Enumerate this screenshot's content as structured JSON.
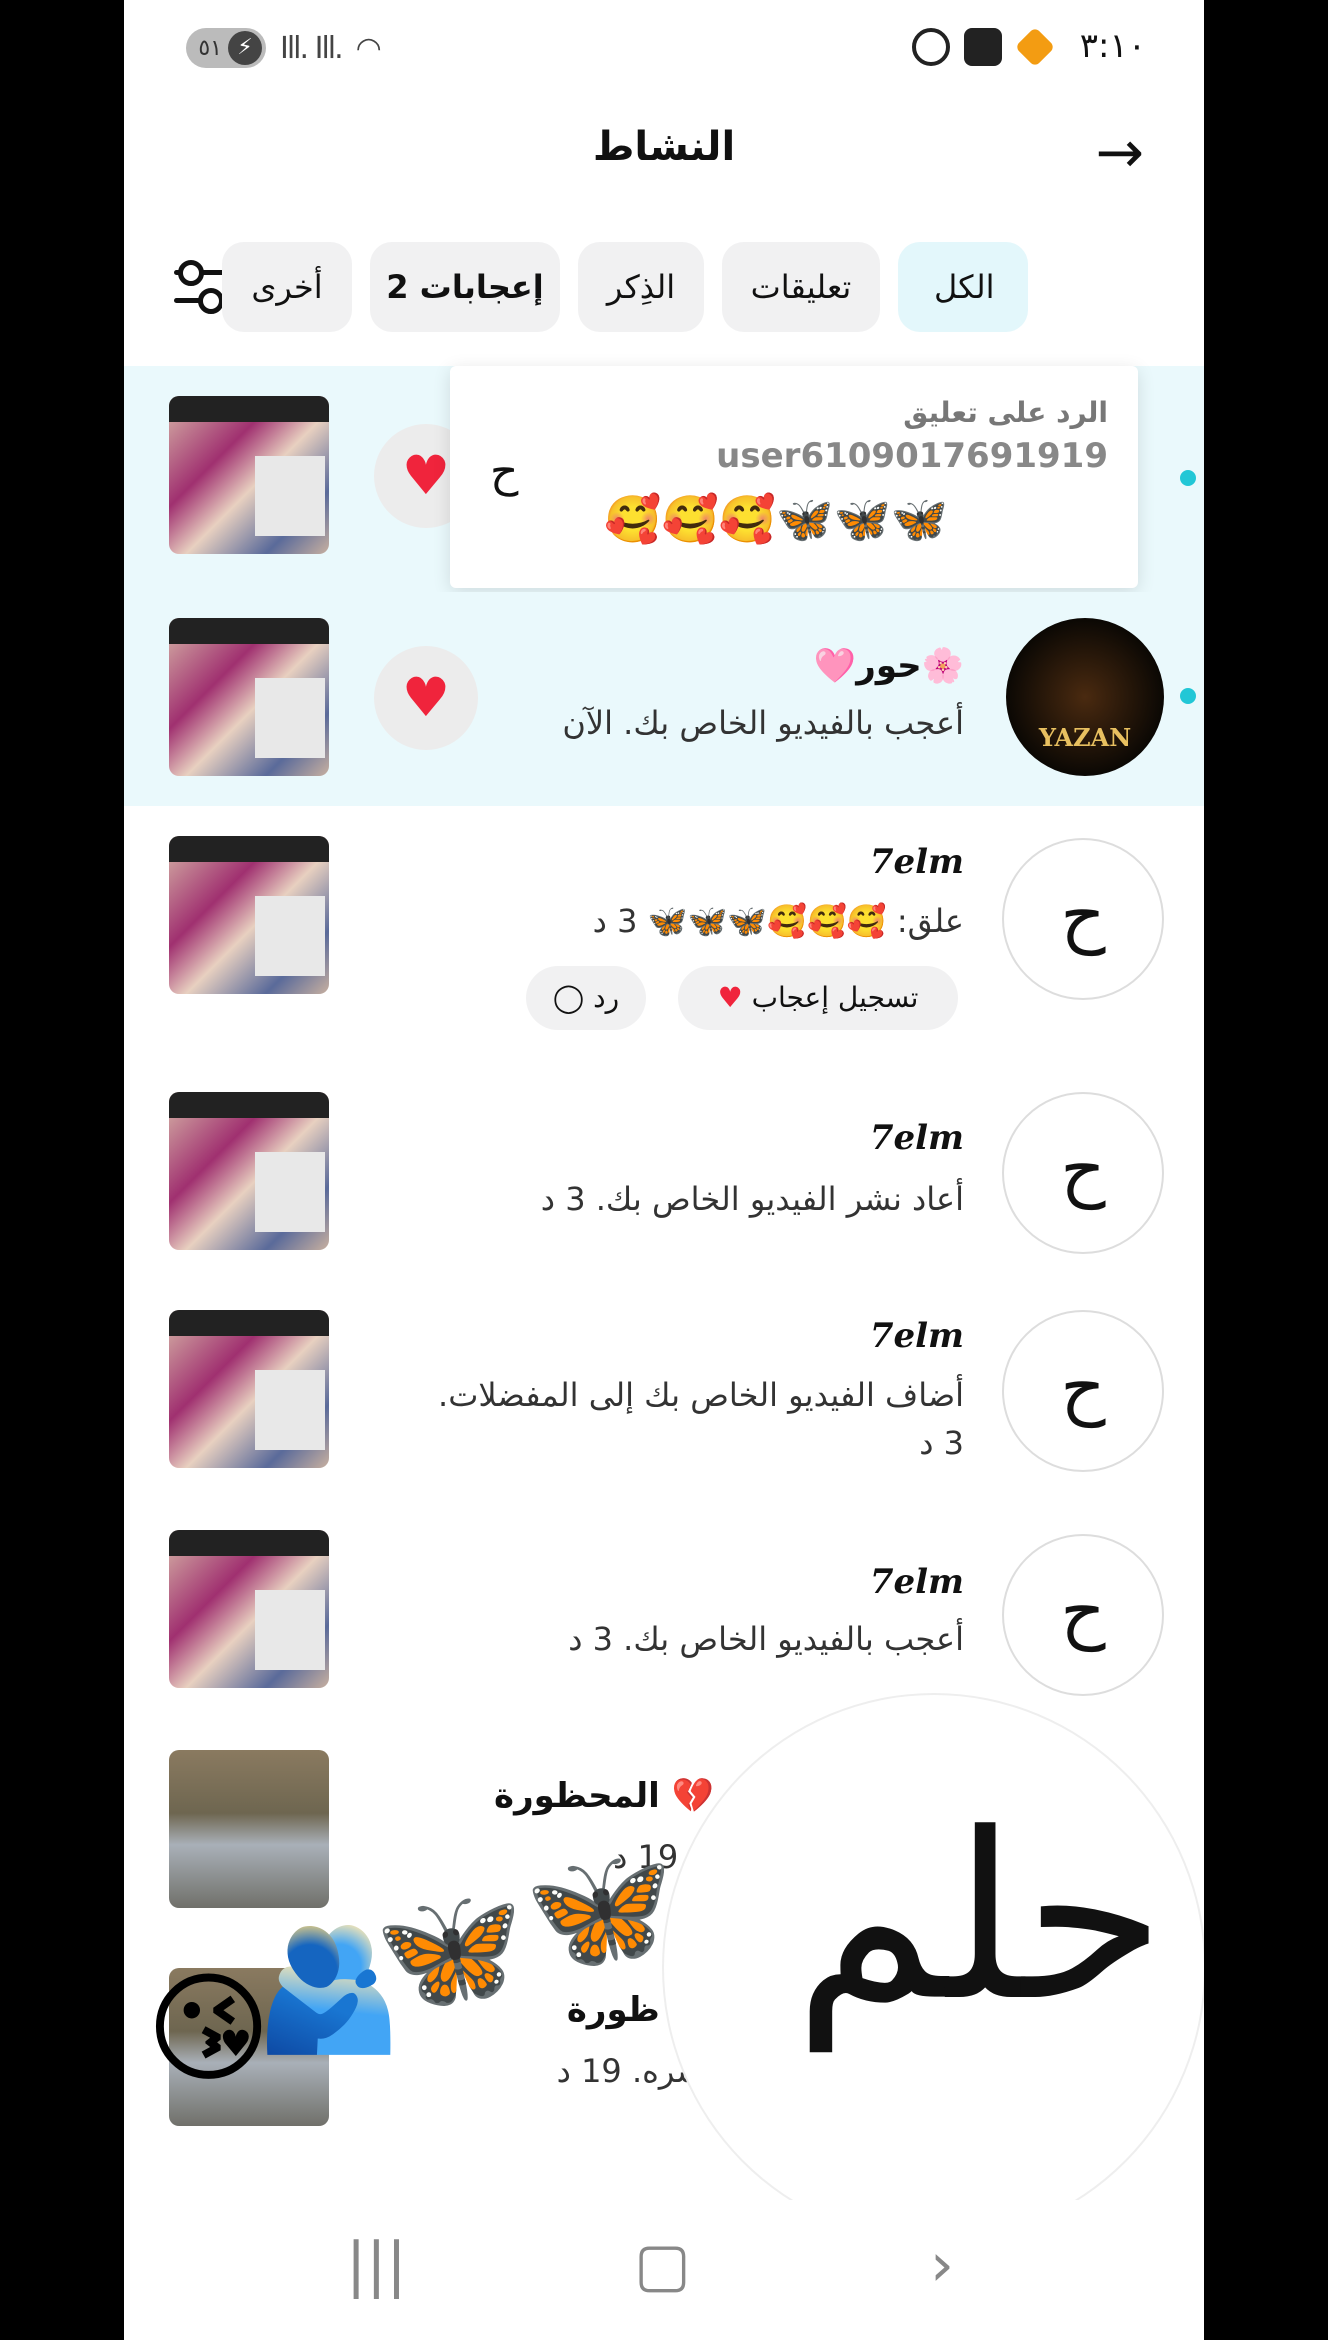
{
  "status_bar": {
    "time": "٣:١٠",
    "battery": "٥١"
  },
  "header": {
    "title": "النشاط"
  },
  "tabs": [
    {
      "label": "الكل"
    },
    {
      "label": "تعليقات"
    },
    {
      "label": "الذِكر"
    },
    {
      "label": "إعجابات 2"
    },
    {
      "label": "أخرى"
    }
  ],
  "popup": {
    "label": "الرد على تعليق",
    "username": "user6109017691919",
    "emojis": "🥰🥰🥰🦋🦋🦋"
  },
  "items": [
    {
      "name": "🩷حور🌸",
      "text": "أعجب بالفيديو الخاص بك. الآن",
      "avatar_text": "YAZAN"
    },
    {
      "name": "7elm",
      "text": "علق: 🥰🥰🥰🦋🦋🦋 3 د",
      "like_label": "تسجيل إعجاب",
      "reply_label": "رد"
    },
    {
      "name": "7elm",
      "text": "أعاد نشر الفيديو الخاص بك. 3 د"
    },
    {
      "name": "7elm",
      "text": "أضاف الفيديو الخاص بك إلى المفضلات.",
      "time": "3 د"
    },
    {
      "name": "7elm",
      "text": "أعجب بالفيديو الخاص بك. 3 د"
    },
    {
      "name": "المحظورة 💔",
      "text": "ر. 19 د"
    },
    {
      "name": "ظورة 💔",
      "text": "نشره. 19 د"
    }
  ],
  "overlay": {
    "calligraphy": "حلم",
    "emojis": [
      "😘",
      "🫂",
      "🦋",
      "🦋"
    ]
  },
  "icons": {
    "back": "arrow-right-icon",
    "filter": "sliders-icon",
    "heart": "heart-icon",
    "comment": "chat-bubble-icon"
  },
  "colors": {
    "accent": "#22c7d6",
    "heart": "#f0243c",
    "highlight_row": "#eaf9fc"
  }
}
